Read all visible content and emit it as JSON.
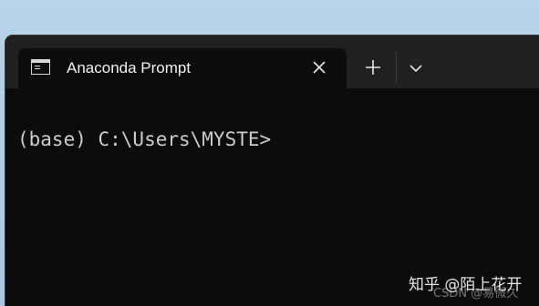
{
  "window": {
    "tab": {
      "title": "Anaconda Prompt",
      "icon": "console-icon",
      "close_icon": "close-icon"
    },
    "new_tab_icon": "plus-icon",
    "dropdown_icon": "chevron-down-icon"
  },
  "terminal": {
    "prompt": "(base) C:\\Users\\MYSTE>"
  },
  "watermark": {
    "zhihu": "知乎 @陌上花开",
    "csdn": "CSDN @易微久"
  },
  "colors": {
    "terminal_bg": "#0c0c0c",
    "titlebar_bg": "#202020",
    "text": "#cccccc"
  }
}
